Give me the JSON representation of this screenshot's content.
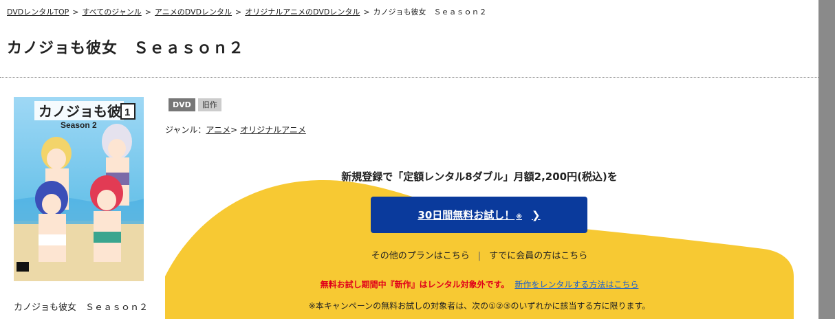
{
  "breadcrumb": {
    "items": [
      "DVDレンタルTOP",
      "すべてのジャンル",
      "アニメのDVDレンタル",
      "オリジナルアニメのDVDレンタル"
    ],
    "current": "カノジョも彼女　Ｓｅａｓｏｎ２",
    "separator": ">"
  },
  "title": "カノジョも彼女　Ｓｅａｓｏｎ２",
  "cover": {
    "logo_text": "カノジョも彼女",
    "subtitle": "Season 2",
    "volume": "1",
    "caption": "カノジョも彼女　Ｓｅａｓｏｎ２"
  },
  "tags": [
    "DVD",
    "旧作"
  ],
  "genre": {
    "label": "ジャンル：",
    "links": [
      "アニメ",
      "オリジナルアニメ"
    ],
    "separator": ">"
  },
  "campaign": {
    "headline": "新規登録で「定額レンタル8ダブル」月額2,200円(税込)を",
    "cta_label": "30日間無料お試し！",
    "cta_mark": "※",
    "other_plans": "その他のプランはこちら",
    "members": "すでに会員の方はこちら",
    "notice_red": "無料お試し期間中『新作』はレンタル対象外です。",
    "notice_link": "新作をレンタルする方法はこちら",
    "note": "※本キャンペーンの無料お試しの対象者は、次の①②③のいずれかに該当する方に限ります。",
    "yellow": "#f7c933",
    "cta_color": "#0a3a9c"
  }
}
